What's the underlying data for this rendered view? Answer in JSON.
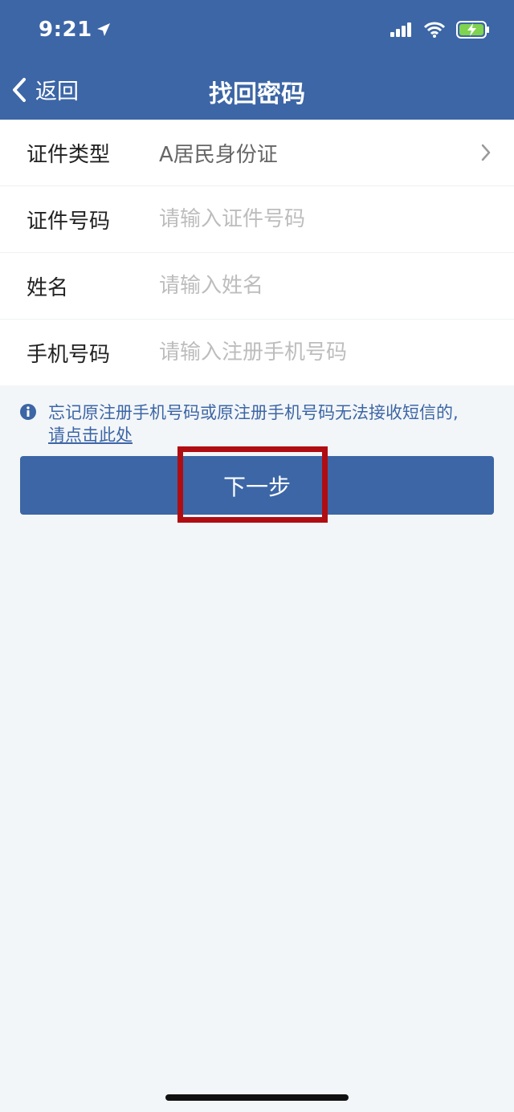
{
  "status_bar": {
    "time": "9:21"
  },
  "nav": {
    "back_label": "返回",
    "title": "找回密码"
  },
  "form": {
    "id_type": {
      "label": "证件类型",
      "value": "A居民身份证"
    },
    "id_number": {
      "label": "证件号码",
      "placeholder": "请输入证件号码"
    },
    "name": {
      "label": "姓名",
      "placeholder": "请输入姓名"
    },
    "phone": {
      "label": "手机号码",
      "placeholder": "请输入注册手机号码"
    }
  },
  "notice": {
    "text": "忘记原注册手机号码或原注册手机号码无法接收短信的,",
    "link": "请点击此处"
  },
  "next_button": {
    "label": "下一步"
  },
  "colors": {
    "primary": "#3c66a6",
    "background": "#f3f6f8",
    "highlight": "#b00d12"
  }
}
